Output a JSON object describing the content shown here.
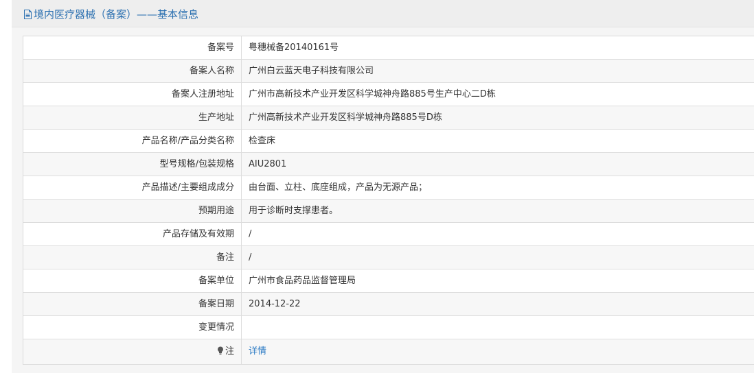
{
  "header": {
    "icon": "document-icon",
    "title": "境内医疗器械（备案）——基本信息",
    "title_color": "#2a6fb0"
  },
  "rows": [
    {
      "label": "备案号",
      "value": "粤穗械备20140161号"
    },
    {
      "label": "备案人名称",
      "value": "广州白云蓝天电子科技有限公司"
    },
    {
      "label": "备案人注册地址",
      "value": "广州市高新技术产业开发区科学城神舟路885号生产中心二D栋"
    },
    {
      "label": "生产地址",
      "value": "广州高新技术产业开发区科学城神舟路885号D栋"
    },
    {
      "label": "产品名称/产品分类名称",
      "value": "检查床"
    },
    {
      "label": "型号规格/包装规格",
      "value": "AIU2801"
    },
    {
      "label": "产品描述/主要组成成分",
      "value": "由台面、立柱、底座组成，产品为无源产品；"
    },
    {
      "label": "预期用途",
      "value": "用于诊断时支撑患者。"
    },
    {
      "label": "产品存储及有效期",
      "value": "/"
    },
    {
      "label": "备注",
      "value": "/"
    },
    {
      "label": "备案单位",
      "value": "广州市食品药品监督管理局"
    },
    {
      "label": "备案日期",
      "value": "2014-12-22"
    },
    {
      "label": "变更情况",
      "value": ""
    }
  ],
  "note_row": {
    "icon": "lightbulb-icon",
    "label": "注",
    "link_text": "详情",
    "link_color": "#2a7ac4"
  }
}
